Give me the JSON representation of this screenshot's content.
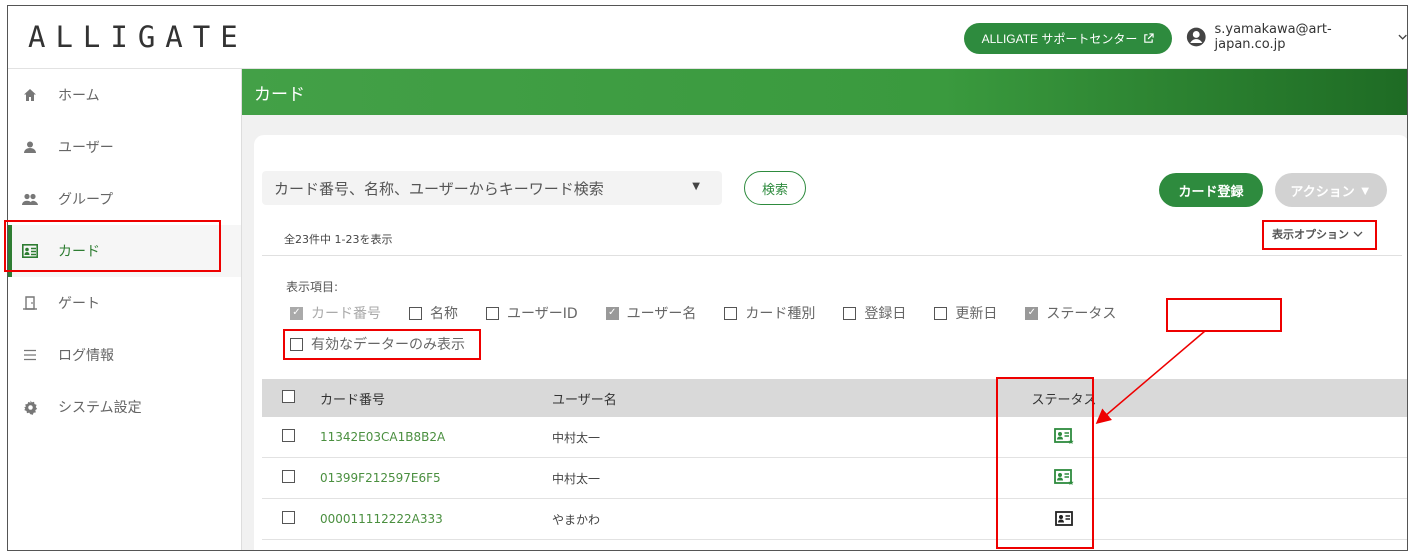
{
  "header": {
    "logo": "ALLIGATE",
    "support_label": "ALLIGATE サポートセンター",
    "user_email": "s.yamakawa@art-japan.co.jp"
  },
  "sidebar": {
    "items": [
      {
        "label": "ホーム",
        "icon": "home-icon"
      },
      {
        "label": "ユーザー",
        "icon": "user-icon"
      },
      {
        "label": "グループ",
        "icon": "group-icon"
      },
      {
        "label": "カード",
        "icon": "card-icon",
        "active": true
      },
      {
        "label": "ゲート",
        "icon": "gate-icon"
      },
      {
        "label": "ログ情報",
        "icon": "list-icon"
      },
      {
        "label": "システム設定",
        "icon": "gear-icon"
      }
    ]
  },
  "page": {
    "title": "カード",
    "search_placeholder": "カード番号、名称、ユーザーからキーワード検索",
    "search_button": "検索",
    "register_button": "カード登録",
    "action_button": "アクション",
    "count_text": "全23件中 1-23を表示",
    "options_toggle": "表示オプション",
    "display_items_label": "表示項目:",
    "display_options": [
      {
        "label": "カード番号",
        "checked": true,
        "disabled": true
      },
      {
        "label": "名称",
        "checked": false
      },
      {
        "label": "ユーザーID",
        "checked": false
      },
      {
        "label": "ユーザー名",
        "checked": true
      },
      {
        "label": "カード種別",
        "checked": false
      },
      {
        "label": "登録日",
        "checked": false
      },
      {
        "label": "更新日",
        "checked": false
      },
      {
        "label": "ステータス",
        "checked": true
      }
    ],
    "valid_only_label": "有効なデーターのみ表示"
  },
  "table": {
    "headers": {
      "card_no": "カード番号",
      "user_name": "ユーザー名",
      "status": "ステータス"
    },
    "rows": [
      {
        "card_no": "11342E03CA1B8B2A",
        "user_name": "中村太一",
        "status": "active"
      },
      {
        "card_no": "01399F212597E6F5",
        "user_name": "中村太一",
        "status": "active"
      },
      {
        "card_no": "000011112222A333",
        "user_name": "やまかわ",
        "status": "inactive"
      }
    ]
  },
  "colors": {
    "accent": "#2e8b3e",
    "highlight": "#ee0000"
  }
}
